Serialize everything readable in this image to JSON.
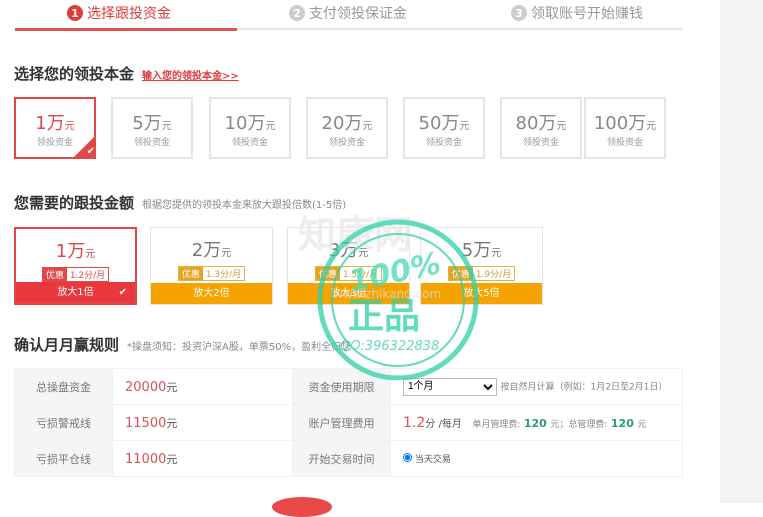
{
  "steps": [
    {
      "num": "1",
      "label": "选择跟投资金"
    },
    {
      "num": "2",
      "label": "支付领投保证金"
    },
    {
      "num": "3",
      "label": "领取账号开始赚钱"
    }
  ],
  "section1": {
    "title": "选择您的领投本金",
    "link": "输入您的领投本金>>",
    "cards": [
      {
        "amount": "1万",
        "unit": "元",
        "sub": "领投资金"
      },
      {
        "amount": "5万",
        "unit": "元",
        "sub": "领投资金"
      },
      {
        "amount": "10万",
        "unit": "元",
        "sub": "领投资金"
      },
      {
        "amount": "20万",
        "unit": "元",
        "sub": "领投资金"
      },
      {
        "amount": "50万",
        "unit": "元",
        "sub": "领投资金"
      },
      {
        "amount": "80万",
        "unit": "元",
        "sub": "领投资金"
      },
      {
        "amount": "100万",
        "unit": "元",
        "sub": "领投资金"
      }
    ]
  },
  "section2": {
    "title": "您需要的跟投金额",
    "hint": "根据您提供的领投本金来放大跟投倍数(1-5倍)",
    "cards": [
      {
        "amount": "1万",
        "unit": "元",
        "badge": "优惠",
        "rate": "1.2分/月",
        "band": "放大1倍"
      },
      {
        "amount": "2万",
        "unit": "元",
        "badge": "优惠",
        "rate": "1.3分/月",
        "band": "放大2倍"
      },
      {
        "amount": "3万",
        "unit": "元",
        "badge": "优惠",
        "rate": "1.5分/月",
        "band": "放大3倍"
      },
      {
        "amount": "5万",
        "unit": "元",
        "badge": "优惠",
        "rate": "1.9分/月",
        "band": "放大5倍"
      }
    ]
  },
  "section3": {
    "title": "确认月月赢规则",
    "hint": "*操盘须知：投资沪深A股，单票50%，盈利全归您",
    "rows": [
      {
        "label1": "总操盘资金",
        "value1": "20000",
        "unit1": "元",
        "label2": "资金使用期限",
        "select": "1个月",
        "note": "按自然月计算（例如：1月2日至2月1日）"
      },
      {
        "label1": "亏损警戒线",
        "value1": "11500",
        "unit1": "元",
        "label2": "账户管理费用",
        "fee": "1.2",
        "fee_unit": "分 /每月",
        "monthly_label": "单月管理费:",
        "monthly": "120",
        "sep": "元；总管理费:",
        "total": "120",
        "total_unit": "元"
      },
      {
        "label1": "亏损平仓线",
        "value1": "11000",
        "unit1": "元",
        "label2": "开始交易时间",
        "radio": "当天交易"
      }
    ]
  },
  "stamp": {
    "top": "知康网",
    "pct": "100%",
    "mid": "正品",
    "qq": "QQ:396322838",
    "site": "www.zhikang.com"
  },
  "colors": {
    "accent": "#e04848",
    "orange": "#f5a300",
    "green": "#2a9d6e"
  }
}
